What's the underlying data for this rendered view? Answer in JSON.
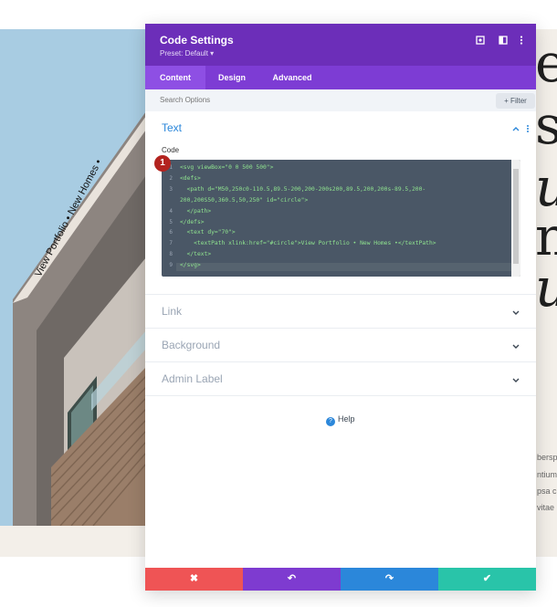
{
  "background": {
    "right_letters": [
      "e",
      "s",
      "u",
      "n",
      "u"
    ],
    "right_small_text": [
      "bersp",
      "ntium",
      "psa c",
      "vitae"
    ],
    "curved_text": "View Portfolio • New Homes •"
  },
  "modal": {
    "title": "Code Settings",
    "preset": "Preset: Default ▾",
    "header_icons": [
      "target-icon",
      "columns-icon",
      "more-icon"
    ],
    "tabs": [
      {
        "label": "Content",
        "active": true
      },
      {
        "label": "Design",
        "active": false
      },
      {
        "label": "Advanced",
        "active": false
      }
    ],
    "search": {
      "placeholder": "Search Options",
      "filter_label": "+ Filter"
    },
    "sections": {
      "text": {
        "title": "Text",
        "code_label": "Code",
        "badge": "1"
      },
      "link": {
        "title": "Link"
      },
      "background": {
        "title": "Background"
      },
      "admin_label": {
        "title": "Admin Label"
      }
    },
    "code_lines": [
      {
        "n": "1",
        "text": "<svg viewBox=\"0 0 500 500\">"
      },
      {
        "n": "2",
        "text": "<defs>"
      },
      {
        "n": "3",
        "text": "  <path d=\"M50,250c0-110.5,89.5-200,200-200s200,89.5,200,200s-89.5,200-"
      },
      {
        "n": "",
        "text": "200,200S50,360.5,50,250\" id=\"circle\">"
      },
      {
        "n": "4",
        "text": "  </path>"
      },
      {
        "n": "5",
        "text": "</defs>"
      },
      {
        "n": "6",
        "text": "  <text dy=\"70\">"
      },
      {
        "n": "7",
        "text": "    <textPath xlink:href=\"#circle\">View Portfolio • New Homes •</textPath>"
      },
      {
        "n": "8",
        "text": "  </text>"
      },
      {
        "n": "9",
        "text": "</svg>"
      }
    ],
    "help_label": "Help",
    "footer": {
      "cancel_icon": "✖",
      "undo_icon": "↶",
      "redo_icon": "↷",
      "save_icon": "✔"
    },
    "colors": {
      "header": "#6c2eb9",
      "tabs": "#7d3cd4",
      "accent_blue": "#2b87da",
      "cancel": "#ef5455",
      "undo": "#7e3bd0",
      "redo": "#2b87da",
      "save": "#29c4a9"
    }
  }
}
